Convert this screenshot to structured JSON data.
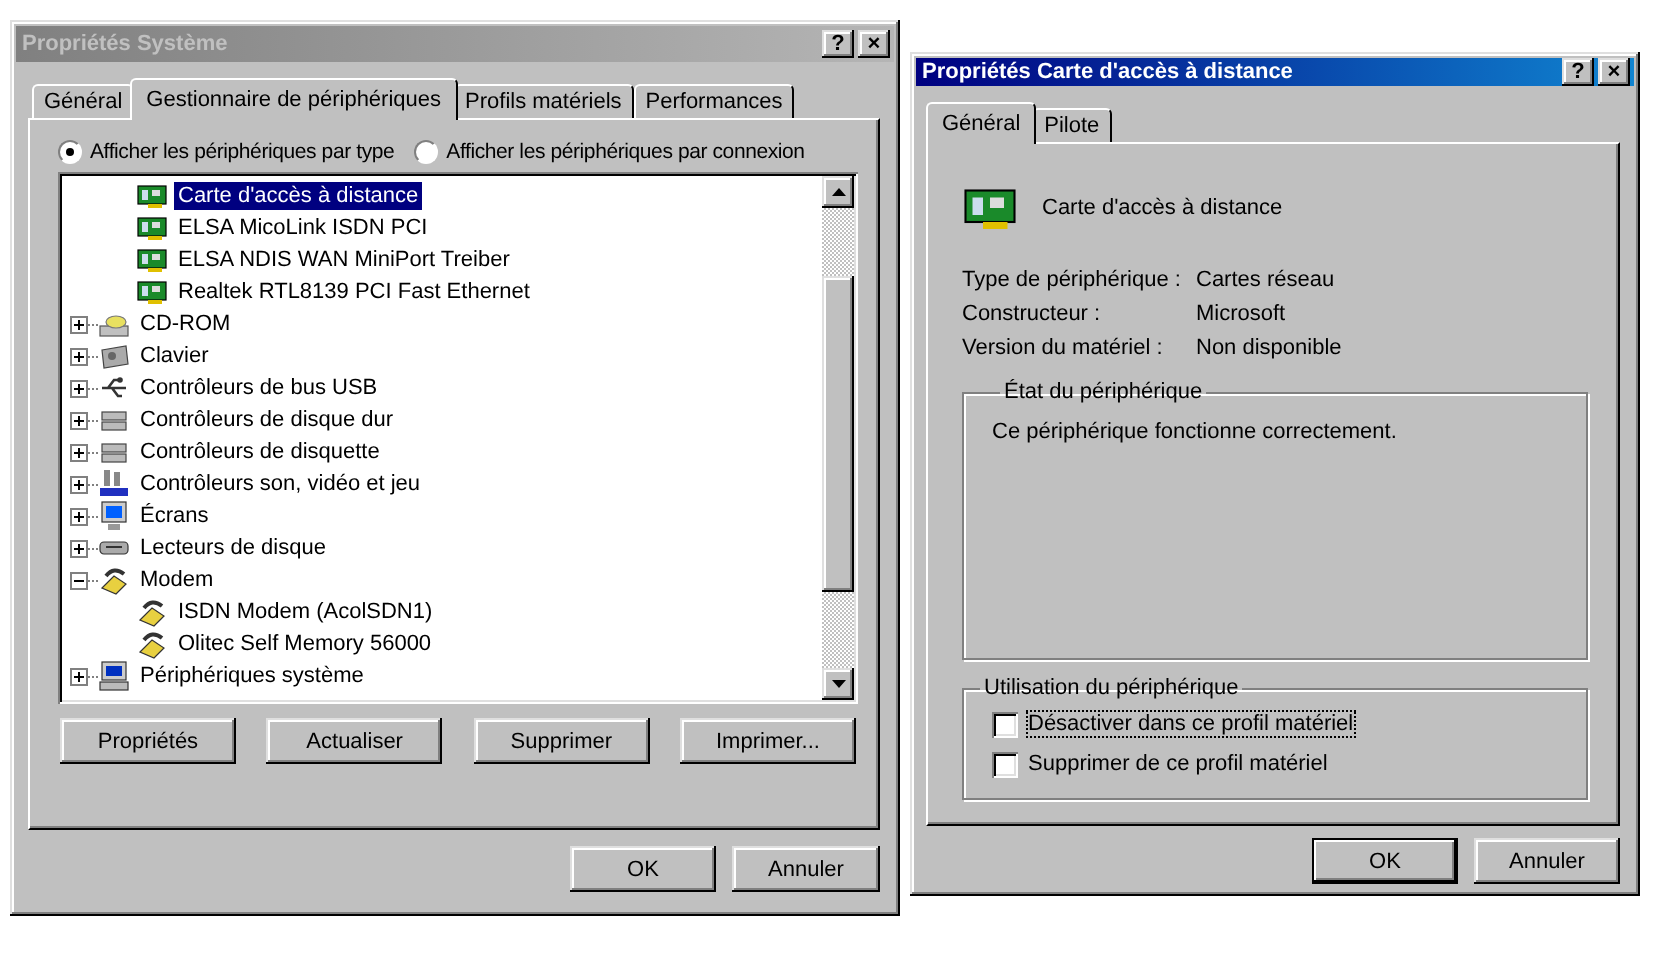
{
  "system_properties": {
    "title": "Propriétés Système",
    "active": false,
    "title_buttons": [
      "?",
      "×"
    ],
    "tabs": [
      {
        "label": "Général",
        "selected": false
      },
      {
        "label": "Gestionnaire de périphériques",
        "selected": true
      },
      {
        "label": "Profils matériels",
        "selected": false
      },
      {
        "label": "Performances",
        "selected": false
      }
    ],
    "view_options": [
      {
        "label": "Afficher les périphériques par type",
        "selected": true
      },
      {
        "label": "Afficher les périphériques par connexion",
        "selected": false
      }
    ],
    "tree": {
      "continued": [
        {
          "label": "Carte d'accès à distance",
          "kind": "card",
          "selected": true
        },
        {
          "label": "ELSA MicoLink ISDN PCI",
          "kind": "card",
          "selected": false
        },
        {
          "label": "ELSA NDIS WAN MiniPort Treiber",
          "kind": "card",
          "selected": false
        },
        {
          "label": "Realtek RTL8139 PCI Fast Ethernet",
          "kind": "card",
          "selected": false
        }
      ],
      "items": [
        {
          "label": "CD-ROM",
          "kind": "cdrom",
          "expanded": false,
          "selected": false
        },
        {
          "label": "Clavier",
          "kind": "keyboard",
          "expanded": false,
          "selected": false
        },
        {
          "label": "Contrôleurs de bus USB",
          "kind": "usb",
          "expanded": false,
          "selected": false
        },
        {
          "label": "Contrôleurs de disque dur",
          "kind": "disk",
          "expanded": false,
          "selected": false
        },
        {
          "label": "Contrôleurs de disquette",
          "kind": "disk",
          "expanded": false,
          "selected": false
        },
        {
          "label": "Contrôleurs son, vidéo et jeu",
          "kind": "sound",
          "expanded": false,
          "selected": false
        },
        {
          "label": "Écrans",
          "kind": "monitor",
          "expanded": false,
          "selected": false
        },
        {
          "label": "Lecteurs de disque",
          "kind": "drive",
          "expanded": false,
          "selected": false
        },
        {
          "label": "Modem",
          "kind": "modem",
          "expanded": true,
          "selected": false,
          "children": [
            {
              "label": "ISDN Modem (AcolSDN1)",
              "kind": "modem",
              "selected": false
            },
            {
              "label": "Olitec Self Memory 56000",
              "kind": "modem",
              "selected": false
            }
          ]
        },
        {
          "label": "Périphériques système",
          "kind": "computer",
          "expanded": false,
          "selected": false
        }
      ]
    },
    "actions": [
      "Propriétés",
      "Actualiser",
      "Supprimer",
      "Imprimer..."
    ],
    "buttons": [
      {
        "label": "OK",
        "default": false
      },
      {
        "label": "Annuler",
        "default": false
      }
    ]
  },
  "device_properties": {
    "title": "Propriétés Carte d'accès à distance",
    "active": true,
    "title_buttons": [
      "?",
      "×"
    ],
    "tabs": [
      {
        "label": "Général",
        "selected": true
      },
      {
        "label": "Pilote",
        "selected": false
      }
    ],
    "device_name": "Carte d'accès à distance",
    "properties": [
      {
        "label": "Type de périphérique :",
        "value": "Cartes réseau"
      },
      {
        "label": "Constructeur :",
        "value": "Microsoft"
      },
      {
        "label": "Version du matériel :",
        "value": "Non disponible"
      }
    ],
    "status_group": {
      "title": "État du périphérique",
      "text": "Ce périphérique fonctionne correctement."
    },
    "usage_group": {
      "title": "Utilisation du périphérique",
      "options": [
        {
          "label": "Désactiver dans ce profil matériel",
          "checked": false,
          "focused": true
        },
        {
          "label": "Supprimer de ce profil matériel",
          "checked": false,
          "focused": false
        }
      ]
    },
    "buttons": [
      {
        "label": "OK",
        "default": true
      },
      {
        "label": "Annuler",
        "default": false
      }
    ]
  }
}
